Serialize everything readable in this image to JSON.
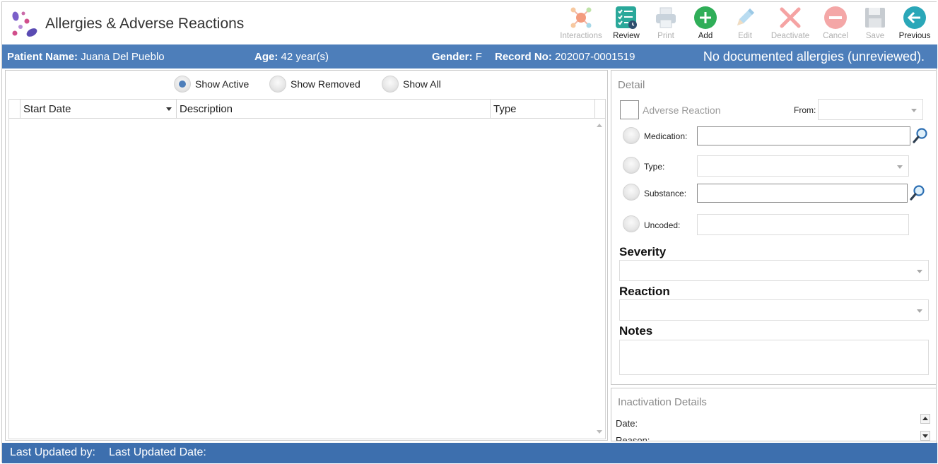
{
  "app": {
    "title": "Allergies & Adverse Reactions",
    "logo_icon": "pills-logo-icon"
  },
  "toolbar": {
    "buttons": [
      {
        "label": "Interactions",
        "icon": "interactions-icon",
        "enabled": false
      },
      {
        "label": "Review",
        "icon": "review-checklist-icon",
        "enabled": true
      },
      {
        "label": "Print",
        "icon": "printer-icon",
        "enabled": false
      },
      {
        "label": "Add",
        "icon": "plus-circle-icon",
        "enabled": true
      },
      {
        "label": "Edit",
        "icon": "pencil-icon",
        "enabled": false
      },
      {
        "label": "Deactivate",
        "icon": "x-mark-icon",
        "enabled": false
      },
      {
        "label": "Cancel",
        "icon": "minus-circle-icon",
        "enabled": false
      },
      {
        "label": "Save",
        "icon": "floppy-disk-icon",
        "enabled": false
      },
      {
        "label": "Previous",
        "icon": "back-arrow-icon",
        "enabled": true
      }
    ]
  },
  "patient": {
    "name_label": "Patient Name:",
    "name_value": "Juana Del Pueblo",
    "age_label": "Age:",
    "age_value": "42 year(s)",
    "gender_label": "Gender:",
    "gender_value": "F",
    "record_label": "Record No:",
    "record_value": "202007-0001519",
    "allergy_status": "No documented allergies (unreviewed)."
  },
  "filter": {
    "options": [
      "Show Active",
      "Show Removed",
      "Show All"
    ],
    "selected": "Show Active"
  },
  "grid": {
    "columns": [
      "Start Date",
      "Description",
      "Type"
    ],
    "rows": []
  },
  "detail": {
    "title": "Detail",
    "adverse_reaction_label": "Adverse Reaction",
    "from_label": "From:",
    "from_value": "",
    "medication_label": "Medication:",
    "medication_value": "",
    "type_label": "Type:",
    "type_value": "",
    "substance_label": "Substance:",
    "substance_value": "",
    "uncoded_label": "Uncoded:",
    "uncoded_value": "",
    "severity_label": "Severity",
    "severity_value": "",
    "reaction_label": "Reaction",
    "reaction_value": "",
    "notes_label": "Notes",
    "notes_value": ""
  },
  "inactivation": {
    "title": "Inactivation Details",
    "date_label": "Date:",
    "reason_label": "Reason:"
  },
  "footer": {
    "last_updated_by_label": "Last Updated by:",
    "last_updated_date_label": "Last Updated Date:"
  },
  "colors": {
    "banner": "#4d7eba",
    "footer": "#3d6fae",
    "accent_green": "#2fae58",
    "accent_teal": "#2aa7b8"
  }
}
